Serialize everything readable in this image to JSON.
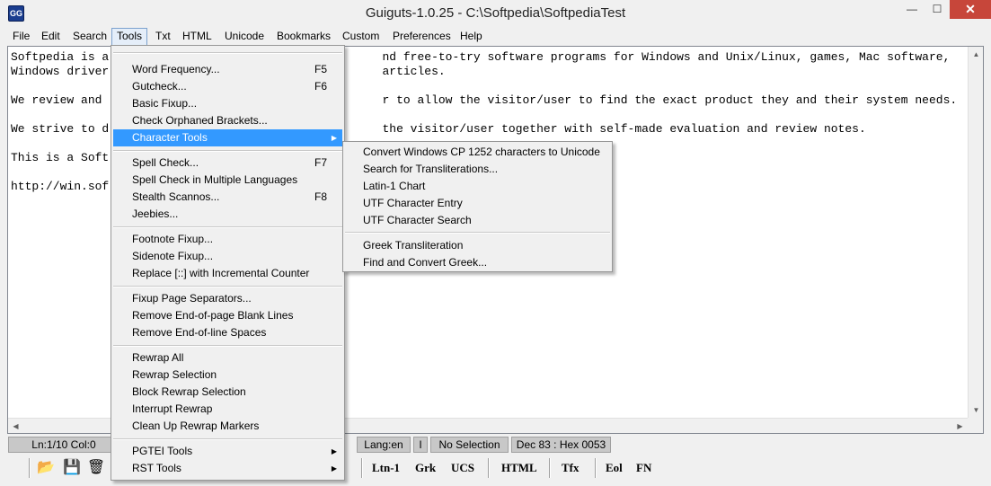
{
  "window": {
    "title": "Guiguts-1.0.25 - C:\\Softpedia\\SoftpediaTest",
    "icon_label": "GG",
    "minimize_glyph": "—",
    "maximize_glyph": "☐",
    "close_glyph": "✕"
  },
  "menubar": {
    "items": [
      {
        "label": "File"
      },
      {
        "label": "Edit"
      },
      {
        "label": "Search"
      },
      {
        "label": "Tools"
      },
      {
        "label": "Txt"
      },
      {
        "label": "HTML"
      },
      {
        "label": "Unicode"
      },
      {
        "label": "Bookmarks"
      },
      {
        "label": "Custom"
      },
      {
        "label": "Preferences"
      },
      {
        "label": "Help"
      }
    ]
  },
  "editor": {
    "lines": [
      {
        "text": "Softpedia is a                                       nd free-to-try software programs for Windows and Unix/Linux, games, Mac software,"
      },
      {
        "text": "Windows driver                                       articles."
      },
      {
        "text": ""
      },
      {
        "text": "We review and                                        r to allow the visitor/user to find the exact product they and their system needs."
      },
      {
        "text": ""
      },
      {
        "text": "We strive to d                                       the visitor/user together with self-made evaluation and review notes."
      },
      {
        "text": ""
      },
      {
        "text": "This is a Soft"
      },
      {
        "text": ""
      },
      {
        "text": "http://win.sof"
      }
    ],
    "scroll_up": "▲",
    "scroll_down": "▼",
    "scroll_left": "◀",
    "scroll_right": "▶"
  },
  "statusbar": {
    "position": "Ln:1/10 Col:0",
    "language": "Lang:en",
    "insert_mode": "I",
    "selection": "No Selection",
    "char_code": "Dec 83 : Hex 0053"
  },
  "toolbar": {
    "open_icon": "📂",
    "save_icon": "💾",
    "delete_icon": "🗑",
    "ltn1": "Ltn-1",
    "grk": "Grk",
    "ucs": "UCS",
    "html": "HTML",
    "tfx": "Tfx",
    "eol": "Eol",
    "fn": "FN"
  },
  "tools_menu": {
    "items": [
      {
        "label": "Word Frequency...",
        "shortcut": "F5"
      },
      {
        "label": "Gutcheck...",
        "shortcut": "F6"
      },
      {
        "label": "Basic Fixup...",
        "shortcut": ""
      },
      {
        "label": "Check Orphaned Brackets...",
        "shortcut": ""
      },
      {
        "label": "Character Tools",
        "shortcut": ""
      },
      {
        "label": "Spell Check...",
        "shortcut": "F7"
      },
      {
        "label": "Spell Check in Multiple Languages",
        "shortcut": ""
      },
      {
        "label": "Stealth Scannos...",
        "shortcut": "F8"
      },
      {
        "label": "Jeebies...",
        "shortcut": ""
      },
      {
        "label": "Footnote Fixup...",
        "shortcut": ""
      },
      {
        "label": "Sidenote Fixup...",
        "shortcut": ""
      },
      {
        "label": "Replace [::] with Incremental Counter",
        "shortcut": ""
      },
      {
        "label": "Fixup Page Separators...",
        "shortcut": ""
      },
      {
        "label": "Remove End-of-page Blank Lines",
        "shortcut": ""
      },
      {
        "label": "Remove End-of-line Spaces",
        "shortcut": ""
      },
      {
        "label": "Rewrap All",
        "shortcut": ""
      },
      {
        "label": "Rewrap Selection",
        "shortcut": ""
      },
      {
        "label": "Block Rewrap Selection",
        "shortcut": ""
      },
      {
        "label": "Interrupt Rewrap",
        "shortcut": ""
      },
      {
        "label": "Clean Up Rewrap Markers",
        "shortcut": ""
      },
      {
        "label": "PGTEI Tools",
        "shortcut": ""
      },
      {
        "label": "RST Tools",
        "shortcut": ""
      }
    ],
    "submenu_arrow": "▶"
  },
  "character_tools_menu": {
    "items": [
      {
        "label": "Convert Windows CP 1252 characters to Unicode"
      },
      {
        "label": "Search for Transliterations..."
      },
      {
        "label": "Latin-1 Chart"
      },
      {
        "label": "UTF Character Entry"
      },
      {
        "label": "UTF Character Search"
      },
      {
        "label": "Greek Transliteration"
      },
      {
        "label": "Find and Convert Greek..."
      }
    ]
  },
  "colors": {
    "highlight": "#3399ff",
    "menu_bg": "#f0f0f0",
    "close_button": "#c7463a",
    "status_cell": "#c8c8c8"
  }
}
